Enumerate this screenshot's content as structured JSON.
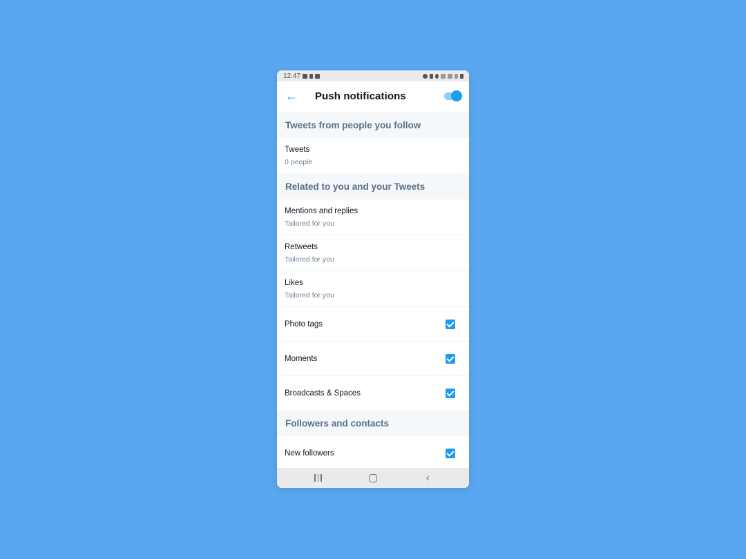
{
  "status_bar": {
    "time": "12:47",
    "left_icons": [
      "gallery-icon",
      "person-icon",
      "notification-icon"
    ],
    "right_icons": [
      "alarm-icon",
      "mute-icon",
      "location-icon",
      "wifi-icon",
      "volte-icon",
      "signal-icon",
      "battery-icon"
    ]
  },
  "header": {
    "back_icon": "arrow-left-icon",
    "title": "Push notifications",
    "toggle_on": true
  },
  "sections": [
    {
      "title": "Tweets from people you follow",
      "items": [
        {
          "label": "Tweets",
          "sub": "0 people"
        }
      ]
    },
    {
      "title": "Related to you and your Tweets",
      "items": [
        {
          "label": "Mentions and replies",
          "sub": "Tailored for you"
        },
        {
          "label": "Retweets",
          "sub": "Tailored for you"
        },
        {
          "label": "Likes",
          "sub": "Tailored for you"
        },
        {
          "label": "Photo tags",
          "checked": true
        },
        {
          "label": "Moments",
          "checked": true
        },
        {
          "label": "Broadcasts & Spaces",
          "checked": true
        }
      ]
    },
    {
      "title": "Followers and contacts",
      "items": [
        {
          "label": "New followers",
          "checked": true
        }
      ]
    }
  ],
  "nav_bar": {
    "buttons": [
      "recents-icon",
      "home-icon",
      "back-icon"
    ]
  },
  "colors": {
    "background": "#5aa7ef",
    "accent": "#1d9bf0",
    "section_bg": "#f5f8fa",
    "section_text": "#5b7083"
  }
}
